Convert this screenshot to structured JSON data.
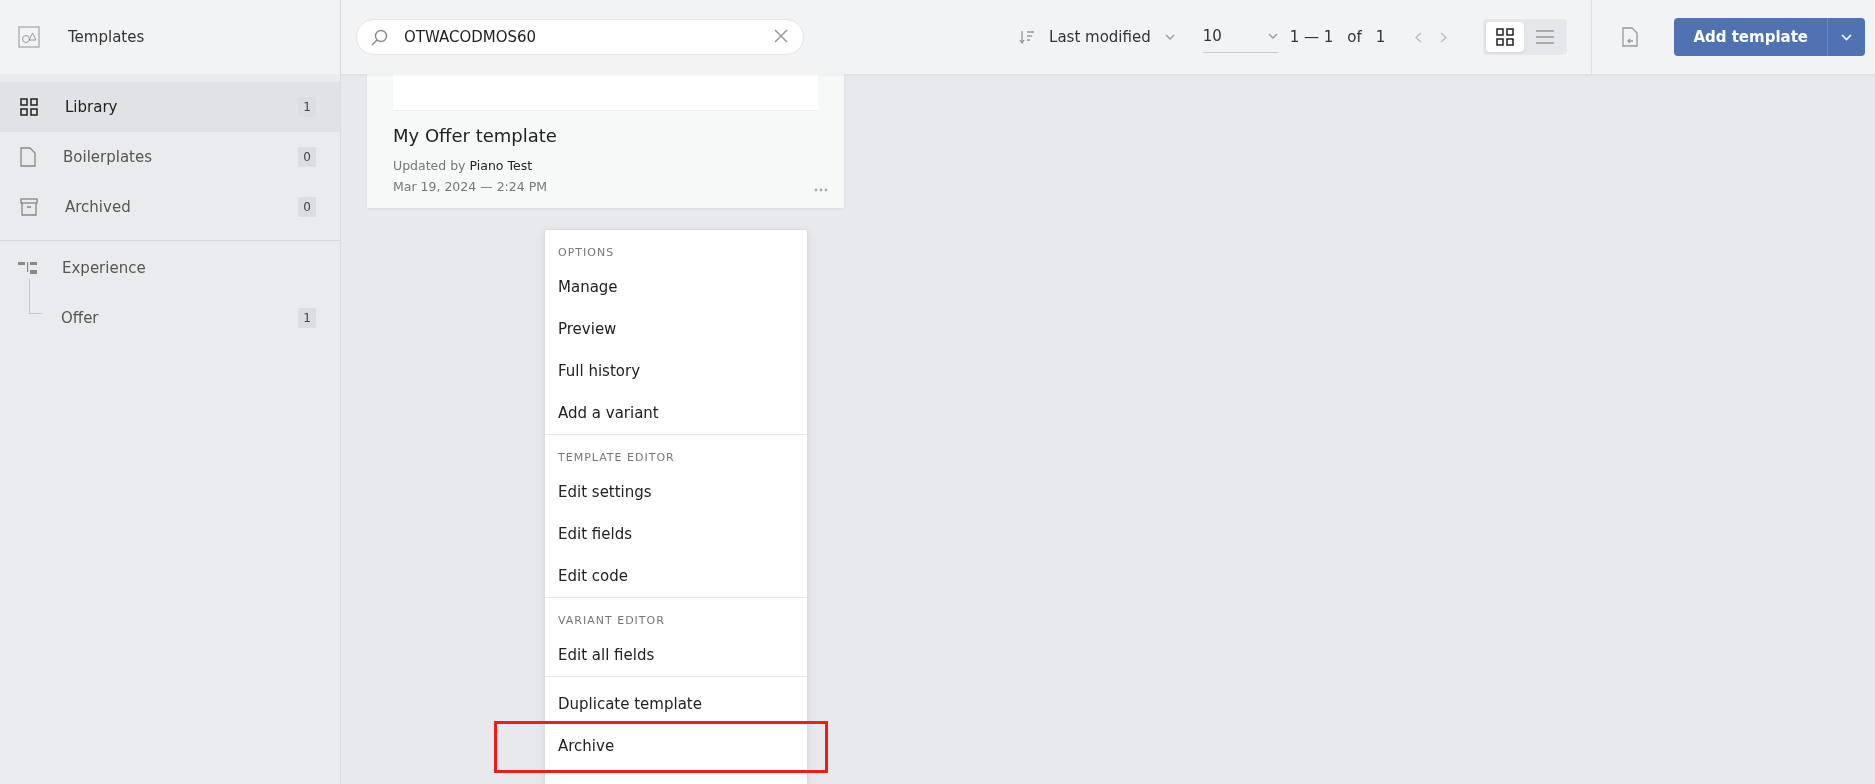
{
  "sidebar": {
    "title": "Templates",
    "items": [
      {
        "kind": "library",
        "label": "Library",
        "count": "1",
        "selected": true
      },
      {
        "kind": "boilerplates",
        "label": "Boilerplates",
        "count": "0",
        "selected": false
      },
      {
        "kind": "archived",
        "label": "Archived",
        "count": "0",
        "selected": false
      }
    ],
    "tree": {
      "label": "Experience",
      "children": [
        {
          "label": "Offer",
          "count": "1"
        }
      ]
    }
  },
  "toolbar": {
    "search": {
      "value": "OTWACODMOS60"
    },
    "sort": "Last modified",
    "page_size": "10",
    "range": "1 — 1",
    "of": "of",
    "total": "1",
    "views": [
      {
        "kind": "grid",
        "selected": true
      },
      {
        "kind": "list",
        "selected": false
      }
    ],
    "add_button": "Add template"
  },
  "card": {
    "title": "My Offer template",
    "updated_prefix": "Updated by",
    "updated_by": "Piano Test",
    "date": "Mar 19, 2024 — 2:24 PM"
  },
  "menu": {
    "sections": [
      {
        "heading": "OPTIONS",
        "items": [
          {
            "label": "Manage",
            "highlighted": false
          },
          {
            "label": "Preview",
            "highlighted": false
          },
          {
            "label": "Full history",
            "highlighted": false
          },
          {
            "label": "Add a variant",
            "highlighted": false
          }
        ]
      },
      {
        "heading": "TEMPLATE EDITOR",
        "items": [
          {
            "label": "Edit settings",
            "highlighted": false
          },
          {
            "label": "Edit fields",
            "highlighted": false
          },
          {
            "label": "Edit code",
            "highlighted": false
          }
        ]
      },
      {
        "heading": "VARIANT EDITOR",
        "items": [
          {
            "label": "Edit all fields",
            "highlighted": false
          }
        ]
      },
      {
        "items": [
          {
            "label": "Duplicate template",
            "highlighted": false
          },
          {
            "label": "Archive",
            "highlighted": true
          }
        ]
      }
    ]
  }
}
